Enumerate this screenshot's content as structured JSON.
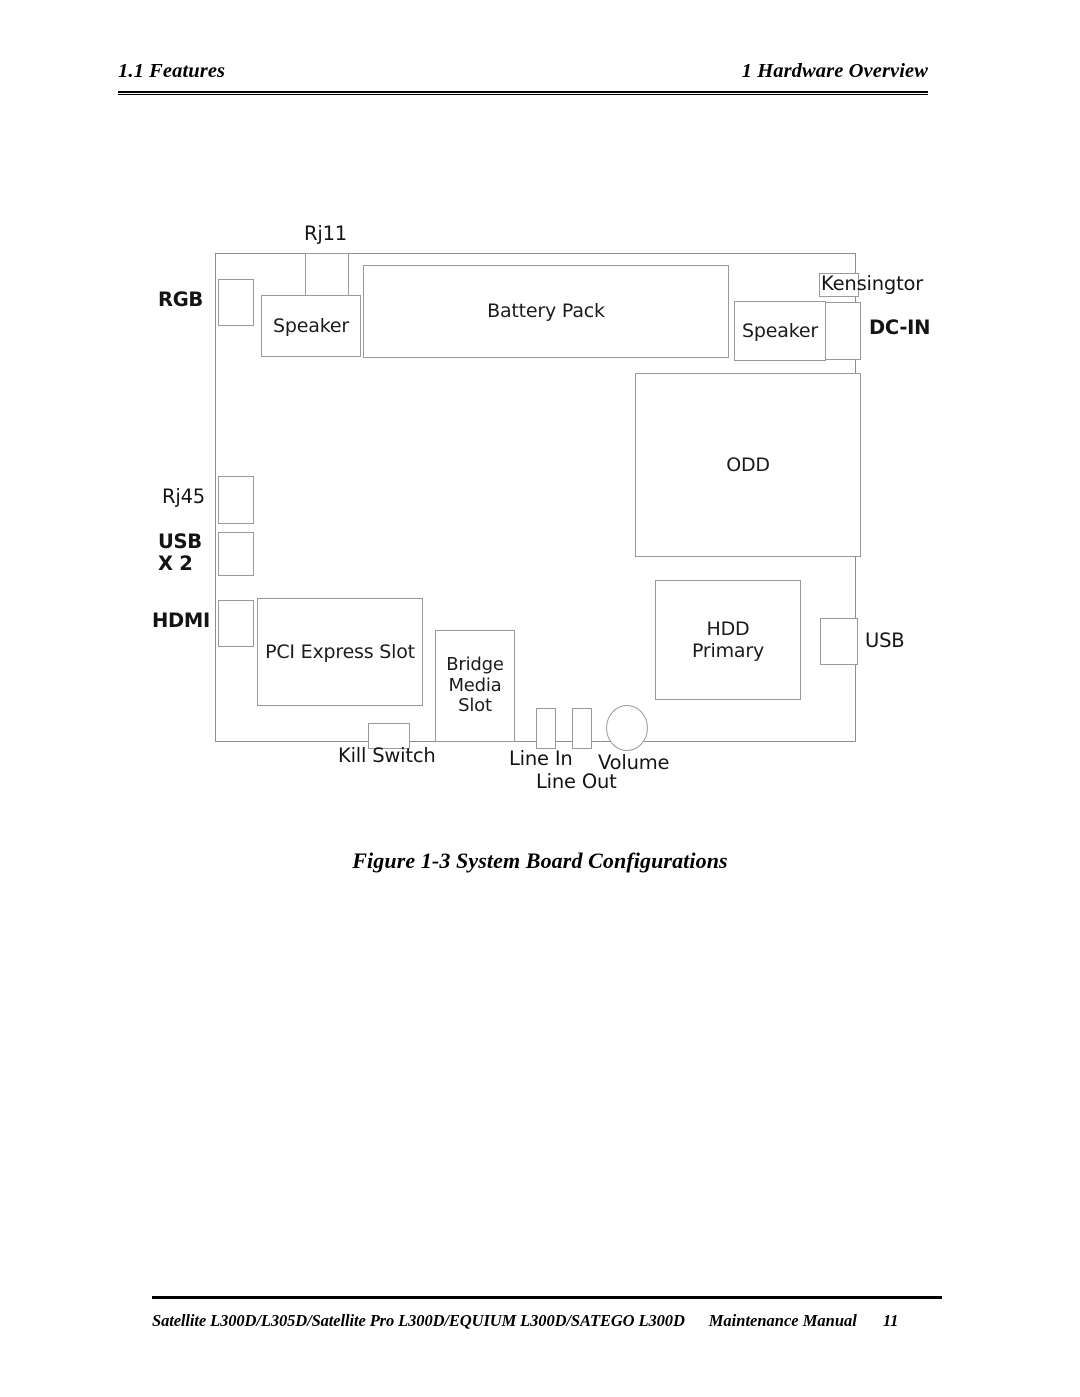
{
  "header": {
    "section_label": "1.1 Features",
    "chapter_label": "1 Hardware Overview"
  },
  "figure": {
    "caption": "Figure 1-3 System Board Configurations",
    "diagram_title": "System Board Configurations",
    "components": {
      "rj11": "Rj11",
      "rgb": "RGB",
      "rj45": "Rj45",
      "usb_left": "USB\nX 2",
      "hdmi": "HDMI",
      "speaker_left": "Speaker",
      "battery_pack": "Battery Pack",
      "speaker_right": "Speaker",
      "kensington": "Kensingtor",
      "dc_in": "DC-IN",
      "odd": "ODD",
      "hdd_primary": "HDD\nPrimary",
      "usb_right": "USB",
      "pci_express_slot": "PCI Express Slot",
      "bridge_media_slot": "Bridge\nMedia\nSlot",
      "kill_switch": "Kill Switch",
      "line_in": "Line In",
      "line_out": "Line Out",
      "volume": "Volume"
    }
  },
  "footer": {
    "models": "Satellite L300D/L305D/Satellite Pro L300D/EQUIUM L300D/SATEGO L300D",
    "manual": "Maintenance Manual",
    "page_number": "11"
  },
  "colors": {
    "text": "#000000",
    "diagram_line": "#9a9a9a",
    "diagram_text": "#1b1b1b",
    "page_background": "#ffffff"
  }
}
